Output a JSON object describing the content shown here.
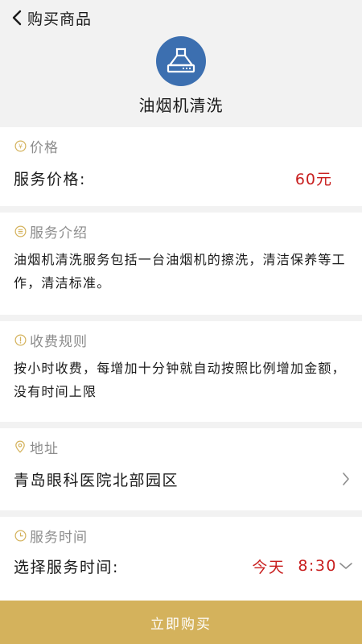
{
  "nav": {
    "title": "购买商品",
    "back_icon": "chevron-left-icon"
  },
  "service": {
    "name": "油烟机清洗",
    "icon": "range-hood-icon",
    "icon_bg": "#3c6fb0"
  },
  "price": {
    "section_title": "价格",
    "icon": "yen-circle-icon",
    "label": "服务价格:",
    "value": "60元"
  },
  "intro": {
    "section_title": "服务介绍",
    "icon": "list-circle-icon",
    "text": "油烟机清洗服务包括一台油烟机的擦洗，清洁保养等工作，清洁标准。"
  },
  "fee": {
    "section_title": "收费规则",
    "icon": "exclamation-circle-icon",
    "text": "按小时收费，每增加十分钟就自动按照比例增加金额，没有时间上限"
  },
  "address": {
    "section_title": "地址",
    "icon": "location-pin-icon",
    "value": "青岛眼科医院北部园区"
  },
  "time": {
    "section_title": "服务时间",
    "icon": "clock-icon",
    "label": "选择服务时间:",
    "day": "今天",
    "clock": "8:30"
  },
  "buy_button": {
    "label": "立即购买"
  },
  "colors": {
    "accent_gold": "#d4b25c",
    "price_red": "#c81e1e",
    "background": "#f2f2f2"
  }
}
